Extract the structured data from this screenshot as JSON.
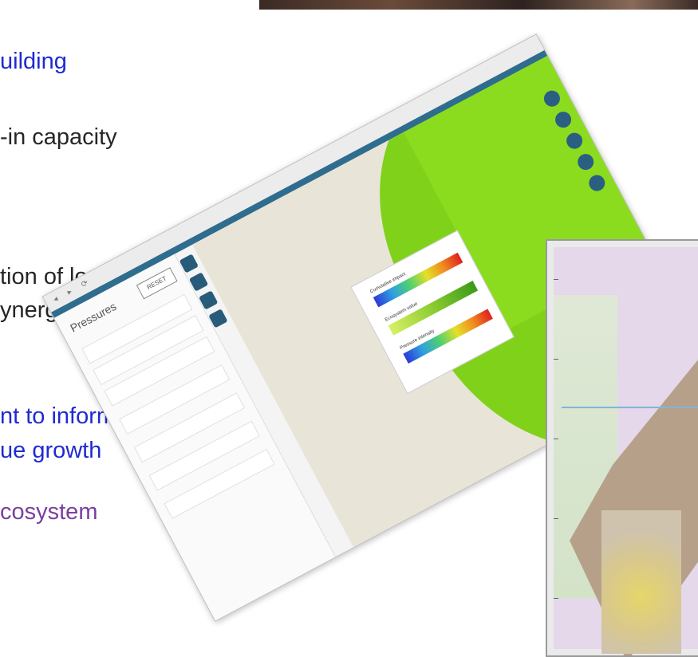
{
  "slide": {
    "lines": [
      {
        "text": "uilding",
        "color_class": "c-blue"
      },
      {
        "text": "-in capacity",
        "color_class": "c-dark"
      },
      {
        "text": "tion of local",
        "color_class": "c-dark"
      },
      {
        "text": "ynergy with",
        "color_class": "c-dark"
      },
      {
        "text": "nt to inform",
        "color_class": "c-blue"
      },
      {
        "text": "ue growth",
        "color_class": "c-blue"
      },
      {
        "text": "cosystem",
        "color_class": "c-purple"
      }
    ]
  },
  "app": {
    "sidebar_title": "Pressures",
    "reset_label": "RESET",
    "legend": {
      "label1": "Cumulative impact",
      "label2": "Ecosystem value",
      "label3": "Pressure intensity"
    }
  },
  "colors": {
    "text_blue": "#1f2ad1",
    "text_dark": "#262626",
    "text_purple": "#7a3fa0",
    "map_green": "#7fd11a",
    "ui_accent": "#2f6d8f"
  }
}
